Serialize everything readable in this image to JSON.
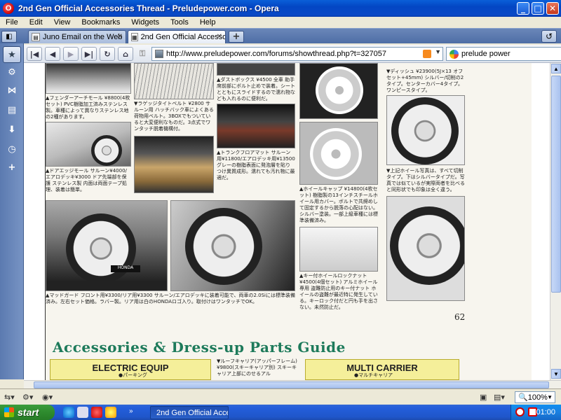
{
  "window": {
    "title": "2nd Gen Official Accessories Thread - Preludepower.com - Opera",
    "min_glyph": "_",
    "max_glyph": "□",
    "close_glyph": "✕"
  },
  "menu": {
    "items": [
      "File",
      "Edit",
      "View",
      "Bookmarks",
      "Widgets",
      "Tools",
      "Help"
    ]
  },
  "tabs": [
    {
      "label": "Juno Email on the Web",
      "active": false
    },
    {
      "label": "2nd Gen Official Accesso...",
      "active": true
    }
  ],
  "tab_close_glyph": "✕",
  "new_tab_glyph": "+",
  "nav": {
    "url": "http://www.preludepower.com/forums/showthread.php?t=327057",
    "search_value": "prelude power"
  },
  "scan": {
    "captions": [
      "▲フェンダーアーチモール ¥8800(4枚セット) PVC樹脂加工済みステンレス製。車種によって異なりステンレス地の2種があります。",
      "▼ラゲッジタイトベルト ¥2800 サルーン用 ハッチバック車によくある荷物用ベルト。3BOXでもついていると大変便利なものだ。3点式でワンタッチ脱着機構付。",
      "▲ダストボックス ¥4500 全車 助手席前部にボルト止めで装着。シートとともにスライドするので濡れ物なども入れるのに便利だ。",
      "▼ディッシュ ¥23900(5J×13 オフセット+45mm) シルバー/切削の2タイプ。センターカバー4タイプ。ワンピースタイプ。",
      "▲ドアエッジモール サルーン¥4000/エアロデッキ¥3000 ドア先端部を保護 ステンレス製 内面は両面テープ処理、装着は簡単。",
      "▲トランクフロアマット サルーン用¥11800/エアロデッキ用¥13500 グレーの樹脂表面に発泡層を貼りつけ異質成形。濡れても汚れ物に最適だ。",
      "▲ホイールキャップ ¥14800(4枚セット) 樹脂製の13インチスチールホイール用カバー。ボルトで共締めして固定するから脱落の心配はない。シルバー塗装。一部上級車種には標準装備済み。",
      "▼上記ホイール写真は、すべて切削タイプ。下はシルバータイプだ。写真では似ているが実際両者を比べると同形状でも印象は全く違う。",
      "▲マッドガード フロント用¥3300/リア用¥3300 サルーン/エアロデッキに装着可能で、両車の2.0Siには標準装備済み。左右セット価格。ラバー製。リア用は白のHONDAロゴ入り。取付けはワンタッチでOK。",
      "▲キー付ホイールロックナット ¥4500(4個セット) アルミホイール専用 盗難防止用のキー付ナット ホイールの盗難が最近特に発生している。キーロック付だと円も手を出さない。未然防止だ。"
    ],
    "mudguard_logo": "HONDA",
    "page_number": "62",
    "guide_title": "Accessories & Dress-up Parts Guide",
    "guide_boxes": [
      "ELECTRIC EQUIP",
      "MULTI CARRIER"
    ],
    "guide_notes": [
      "▼ルーフキャリア(アッパーフレーム) ¥9800(スキーキャリア別) スキーキャリア上部にのせるアル",
      "●パーキング",
      "●マルチキャリア"
    ]
  },
  "status": {
    "zoom": "100%"
  },
  "taskbar": {
    "start_label": "start",
    "task_label": "2nd Gen Official Acce...",
    "clock": "01:00",
    "ql_more": "»"
  },
  "colors": {
    "titlebar": "#0346c4",
    "panel": "#5b7ab0",
    "guide_green": "#1d7a5a",
    "guide_box": "#f5ef9a",
    "start_green": "#2e8b2e"
  },
  "icons": {
    "opera": "opera-logo-icon",
    "panel": [
      "bookmarks-icon",
      "settings-icon",
      "share-icon",
      "notes-icon",
      "downloads-icon",
      "history-icon",
      "add-panel-icon"
    ],
    "nav": [
      "rewind-icon",
      "back-icon",
      "forward-icon",
      "fast-forward-icon",
      "reload-icon",
      "home-icon",
      "key-icon"
    ]
  }
}
